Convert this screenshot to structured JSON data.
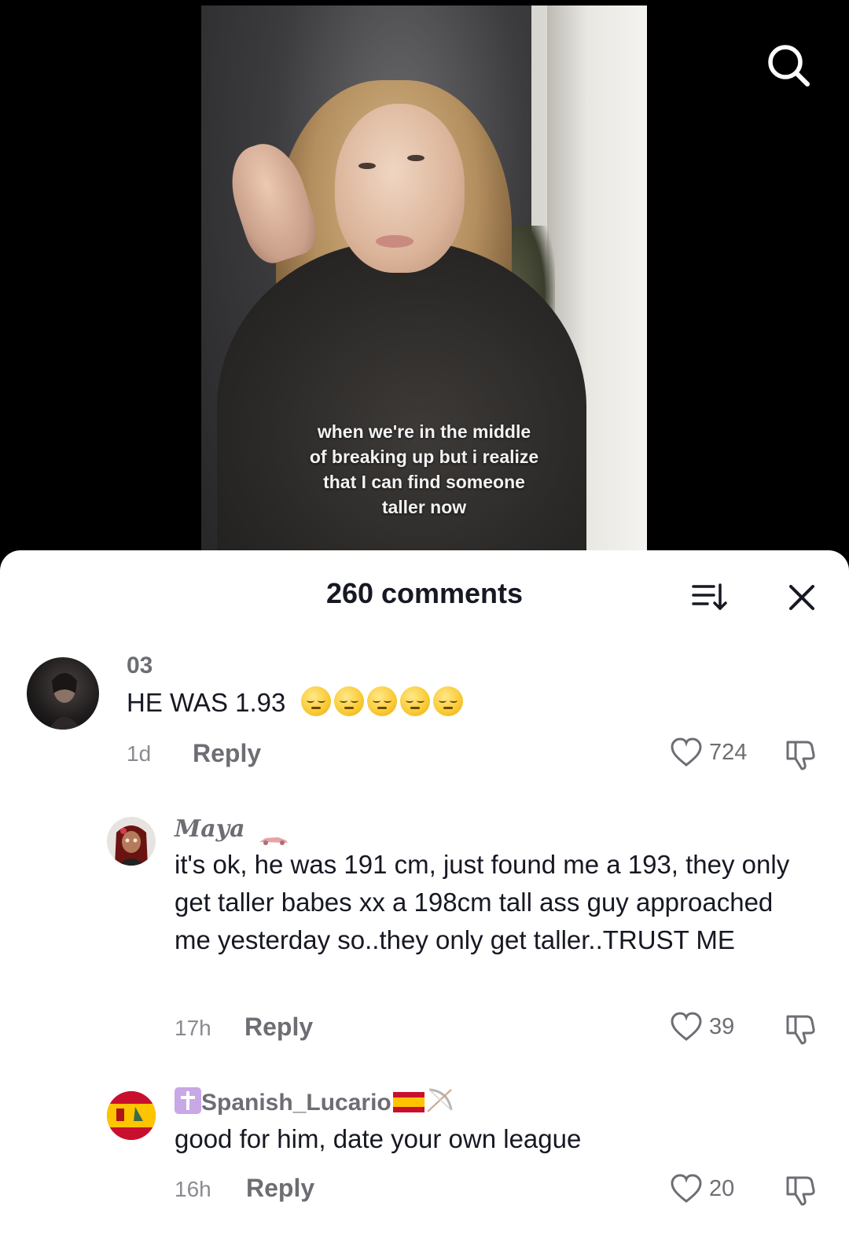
{
  "video": {
    "caption": "when we're in the middle\nof breaking up but i realize\nthat I can find someone\ntaller now"
  },
  "icons": {
    "search": "search-icon",
    "sort": "sort-icon",
    "close": "close-icon",
    "like": "heart-icon",
    "dislike": "thumbs-down-icon"
  },
  "comments_sheet": {
    "title": "260 comments"
  },
  "comments": [
    {
      "username": "03",
      "text": "HE WAS 1.93",
      "emoji_count": 5,
      "time": "1d",
      "reply_label": "Reply",
      "likes": "724"
    },
    {
      "username": "Maya",
      "text": "it's ok, he was 191 cm, just found me a 193, they only get taller babes xx a 198cm tall ass guy approached me yesterday so..they only get taller..TRUST ME",
      "time": "17h",
      "reply_label": "Reply",
      "likes": "39"
    },
    {
      "username": "Spanish_Lucario",
      "text": "good for him, date your own league",
      "time": "16h",
      "reply_label": "Reply",
      "likes": "20"
    }
  ],
  "colors": {
    "text_primary": "#161823",
    "text_secondary": "#6d6e74",
    "sheet_bg": "#ffffff",
    "video_bg": "#000000"
  }
}
